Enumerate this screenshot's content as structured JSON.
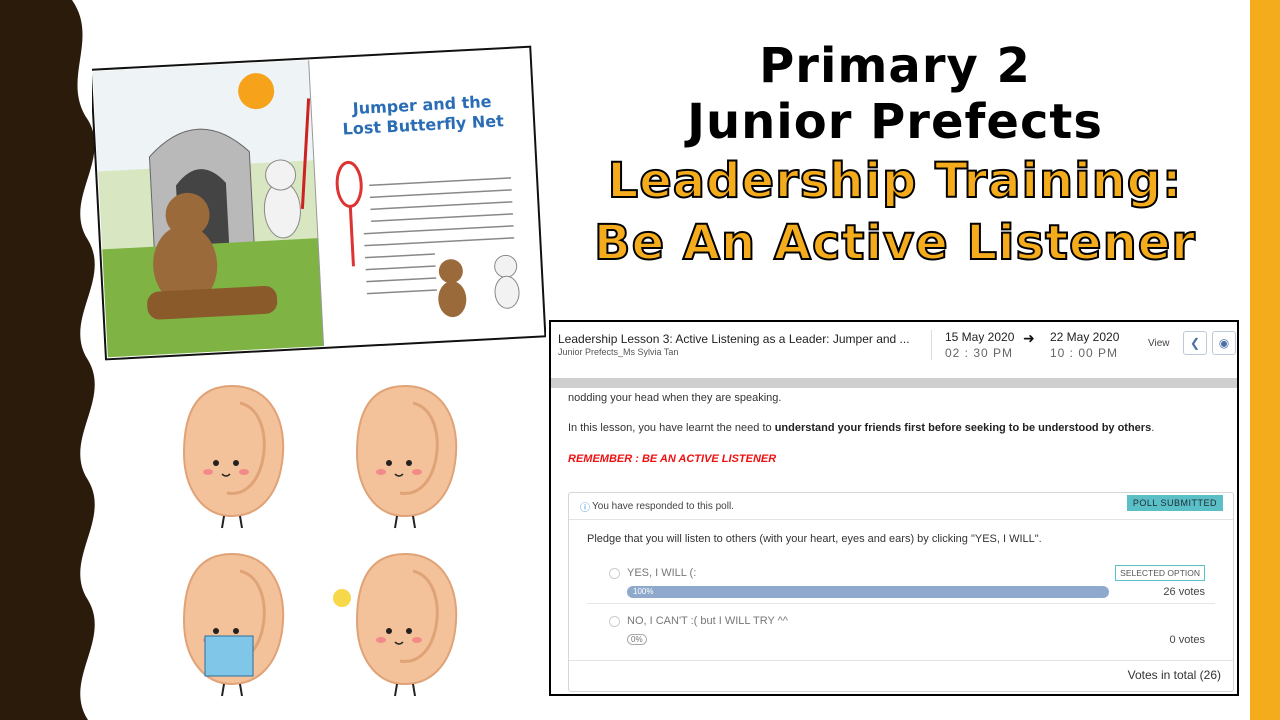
{
  "slide": {
    "title_line1": "Primary 2",
    "title_line2": "Junior Prefects",
    "subtitle_line1": "Leadership Training:",
    "subtitle_line2": "Be An Active Listener",
    "colors": {
      "accent": "#F5AC1C",
      "border_dark": "#2a1b0a"
    }
  },
  "book": {
    "title_line1": "Jumper and the",
    "title_line2": "Lost Butterfly Net"
  },
  "lesson": {
    "title": "Leadership Lesson 3: Active Listening as a Leader: Jumper and ...",
    "group": "Junior Prefects_Ms Sylvia Tan",
    "start_date": "15 May 2020",
    "start_time": "02 : 30 PM",
    "end_date": "22 May 2020",
    "end_time": "10 : 00 PM",
    "view_label": "View",
    "body_line1": "nodding your head when they are speaking.",
    "body_line2_prefix": "In this lesson, you have learnt the need to ",
    "body_line2_bold": "understand your friends first before seeking to be understood by others",
    "body_line2_suffix": ".",
    "remember": "REMEMBER : BE AN ACTIVE LISTENER"
  },
  "poll": {
    "status_msg": "You have responded to this poll.",
    "submitted_badge": "POLL SUBMITTED",
    "question": "Pledge that you will listen to others (with your heart, eyes and ears) by clicking \"YES, I WILL\".",
    "options": [
      {
        "label": "YES, I WILL (:",
        "percent": "100%",
        "votes": "26 votes",
        "selected_badge": "SELECTED OPTION",
        "fill": 1.0
      },
      {
        "label": "NO, I CAN'T :( but I WILL TRY ^^",
        "percent": "0%",
        "votes": "0 votes",
        "fill": 0.0
      }
    ],
    "total": "Votes in total (26)"
  }
}
